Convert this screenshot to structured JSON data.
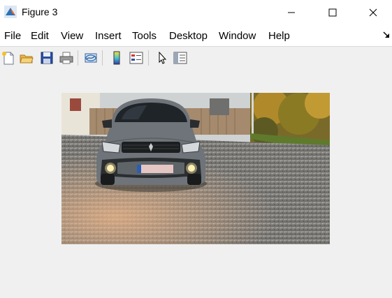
{
  "window": {
    "title": "Figure 3"
  },
  "menu": [
    "File",
    "Edit",
    "View",
    "Insert",
    "Tools",
    "Desktop",
    "Window",
    "Help"
  ],
  "toolbar_icons": [
    "new-figure-icon",
    "open-file-icon",
    "save-icon",
    "print-icon",
    "link-plot-icon",
    "insert-colorbar-icon",
    "insert-legend-icon",
    "edit-plot-icon",
    "property-inspector-icon"
  ],
  "window_controls": [
    "minimize-icon",
    "maximize-icon",
    "close-icon"
  ],
  "colors": {
    "titlebar": "#ffffff",
    "background": "#f0f0f0",
    "matlab_orange": "#e8602c"
  }
}
